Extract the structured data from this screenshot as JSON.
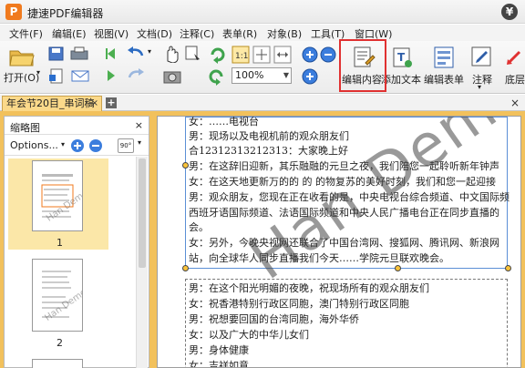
{
  "app": {
    "title": "捷速PDF编辑器",
    "logo_letter": "P"
  },
  "menu": [
    "文件(F)",
    "编辑(E)",
    "视图(V)",
    "文档(D)",
    "注释(C)",
    "表单(R)",
    "对象(B)",
    "工具(T)",
    "窗口(W)"
  ],
  "toolbar": {
    "open_label": "打开(O)",
    "zoom_value": "100%",
    "edit_content_label": "编辑内容",
    "add_text_label": "添加文本",
    "edit_form_label": "编辑表单",
    "annotate_label": "注释",
    "bottom_label": "底层"
  },
  "tab": {
    "title": "年会节20目_串词稿",
    "close": "×",
    "new": "+",
    "panel_close": "×"
  },
  "thumbnails": {
    "title": "缩略图",
    "close": "×",
    "options_label": "Options...",
    "rotate_label": "90°",
    "pages": [
      "1",
      "2"
    ]
  },
  "document": {
    "top_lines": [
      "女：……电视台",
      "男：现场以及电视机前的观众朋友们",
      "合12312313212313：大家晚上好",
      "男：在这辞旧迎新，其乐融融的元旦之夜，我们陪您一起聆听新年钟声",
      "女：在这天地更新万的的 的 的物复苏的美好时刻，我们和您一起迎接",
      "男：观众朋友，您现在正在收看的是，中央电视台综合频道、中文国际频",
      "西班牙语国际频道、法语国际频道和中央人民广播电台正在同步直播的",
      "会。",
      "女：另外，今晚央视网还联合了中国台湾网、搜狐网、腾讯网、新浪网",
      "站，向全球华人同步直播我们今天……学院元旦联欢晚会。"
    ],
    "bottom_lines": [
      "男：在这个阳光明媚的夜晚，祝现场所有的观众朋友们",
      "女：祝香港特别行政区同胞，澳门特别行政区同胞",
      "男：祝想要回国的台湾同胞，海外华侨",
      "女：以及广大的中华儿女们",
      "男：身体健康",
      "女：吉祥如意"
    ],
    "watermark": "Han Demo"
  }
}
